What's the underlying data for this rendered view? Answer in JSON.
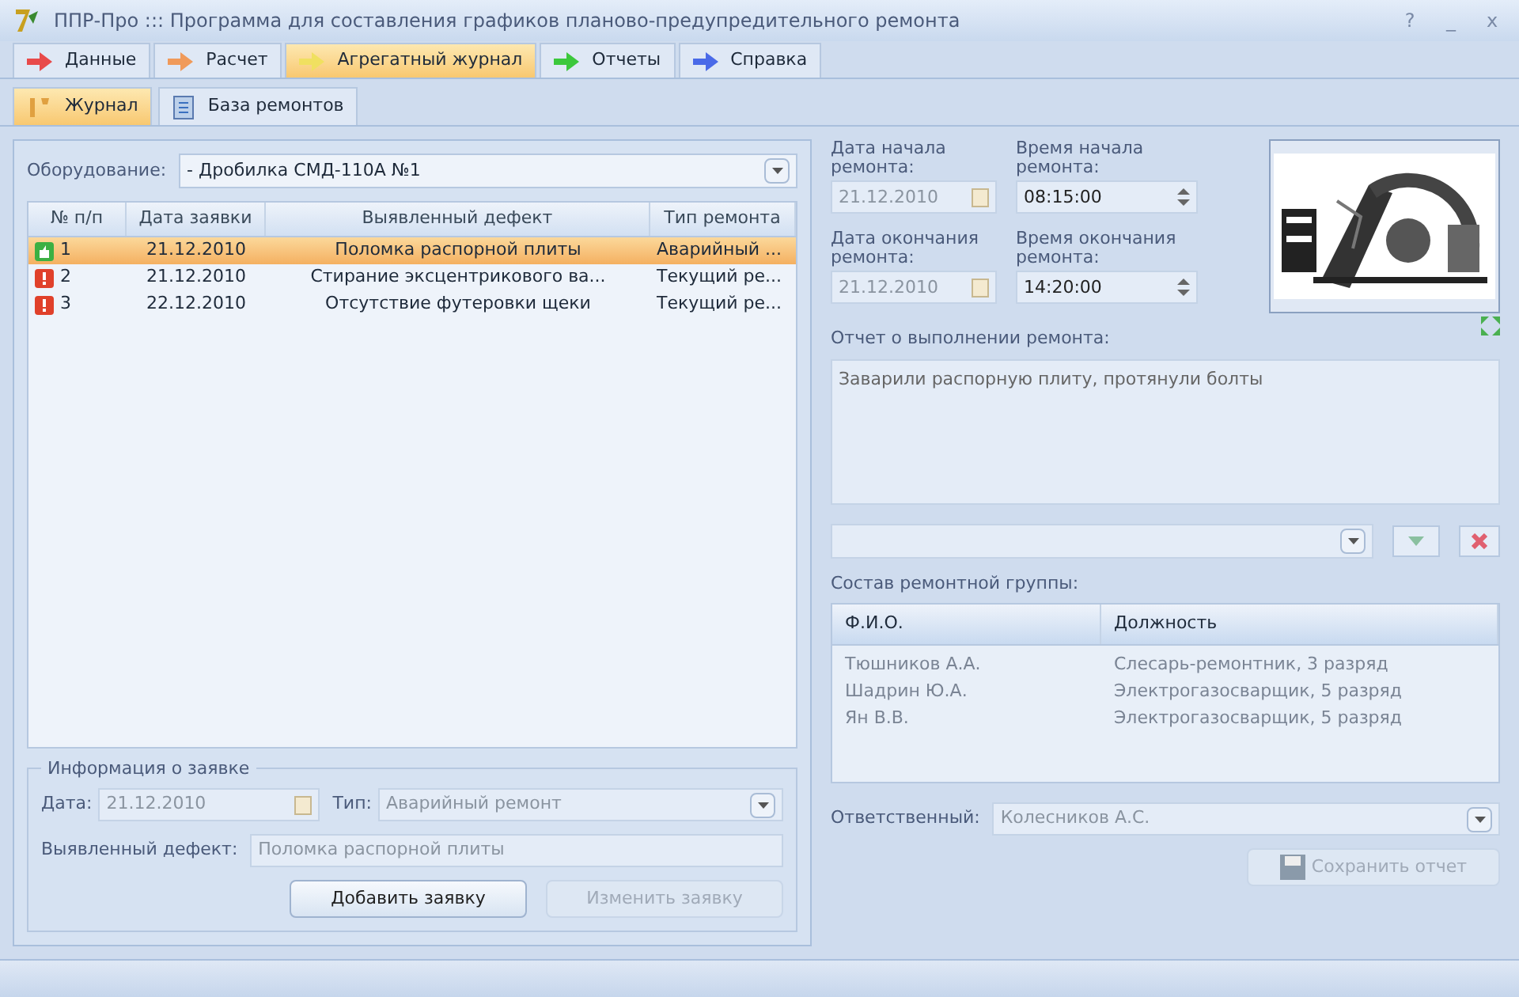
{
  "window": {
    "title": "ППР-Про ::: Программа для составления графиков планово-предупредительного ремонта",
    "controls": [
      "?",
      "_",
      "x"
    ]
  },
  "tabs": [
    {
      "label": "Данные",
      "selected": false,
      "color": "#e84a4a"
    },
    {
      "label": "Расчет",
      "selected": false,
      "color": "#f09a5a"
    },
    {
      "label": "Агрегатный журнал",
      "selected": true,
      "color": "#f0e060"
    },
    {
      "label": "Отчеты",
      "selected": false,
      "color": "#3cc83c"
    },
    {
      "label": "Справка",
      "selected": false,
      "color": "#4a6ae8"
    }
  ],
  "subtabs": [
    {
      "label": "Журнал",
      "selected": true
    },
    {
      "label": "База ремонтов",
      "selected": false
    }
  ],
  "equipment": {
    "label": "Оборудование:",
    "value": "- Дробилка СМД-110А №1"
  },
  "table": {
    "columns": [
      "№ п/п",
      "Дата заявки",
      "Выявленный дефект",
      "Тип ремонта"
    ],
    "rows": [
      {
        "kind": "ok",
        "selected": true,
        "cells": [
          "1",
          "21.12.2010",
          "Поломка распорной плиты",
          "Аварийный ..."
        ]
      },
      {
        "kind": "alert",
        "selected": false,
        "cells": [
          "2",
          "21.12.2010",
          "Стирание эксцентрикового ва...",
          "Текущий ре..."
        ]
      },
      {
        "kind": "alert",
        "selected": false,
        "cells": [
          "3",
          "22.12.2010",
          "Отсутствие футеровки щеки",
          "Текущий ре..."
        ]
      }
    ]
  },
  "request_info": {
    "title": "Информация о заявке",
    "date_label": "Дата:",
    "date": "21.12.2010",
    "type_label": "Тип:",
    "type": "Аварийный ремонт",
    "defect_label": "Выявленный дефект:",
    "defect": "Поломка распорной плиты",
    "buttons": [
      {
        "label": "Добавить заявку",
        "disabled": false
      },
      {
        "label": "Изменить заявку",
        "disabled": true
      }
    ]
  },
  "repair": {
    "start_date_label": "Дата начала ремонта:",
    "start_date": "21.12.2010",
    "start_time_label": "Время начала ремонта:",
    "start_time": "08:15:00",
    "end_date_label": "Дата окончания ремонта:",
    "end_date": "21.12.2010",
    "end_time_label": "Время окончания ремонта:",
    "end_time": "14:20:00",
    "report_label": "Отчет о выполнении ремонта:",
    "report": "Заварили распорную плиту, протянули болты"
  },
  "team": {
    "label": "Состав ремонтной группы:",
    "columns": [
      "Ф.И.О.",
      "Должность"
    ],
    "rows": [
      [
        "Тюшников А.А.",
        "Слесарь-ремонтник, 3 разряд"
      ],
      [
        "Шадрин Ю.А.",
        "Электрогазосварщик, 5 разряд"
      ],
      [
        "Ян В.В.",
        "Электрогазосварщик, 5 разряд"
      ]
    ]
  },
  "responsible": {
    "label": "Ответственный:",
    "value": "Колесников А.С."
  },
  "save_button": {
    "label": "Сохранить отчет",
    "disabled": true
  }
}
